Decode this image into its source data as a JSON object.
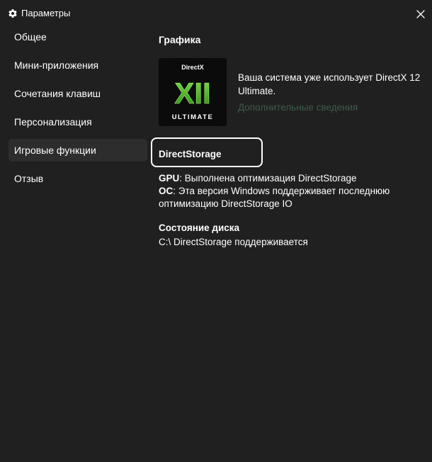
{
  "window": {
    "title": "Параметры"
  },
  "sidebar": {
    "items": [
      {
        "label": "Общее",
        "active": false
      },
      {
        "label": "Мини-приложения",
        "active": false
      },
      {
        "label": "Сочетания клавиш",
        "active": false
      },
      {
        "label": "Персонализация",
        "active": false
      },
      {
        "label": "Игровые функции",
        "active": true
      },
      {
        "label": "Отзыв",
        "active": false
      }
    ]
  },
  "main": {
    "section_title": "Графика",
    "directx": {
      "logo_top": "DirectX",
      "logo_numeral": "XII",
      "logo_bottom": "ULTIMATE",
      "description": "Ваша система уже использует DirectX 12 Ultimate.",
      "link": "Дополнительные сведения"
    },
    "directstorage": {
      "title": "DirectStorage",
      "gpu_label": "GPU",
      "gpu_text": ": Выполнена оптимизация DirectStorage",
      "os_label": "ОС",
      "os_text_1": ": Эта версия Windows поддерживает последнюю",
      "os_text_2": "оптимизацию DirectStorage IO"
    },
    "disk": {
      "title": "Состояние диска",
      "status": "C:\\ DirectStorage поддерживается"
    }
  },
  "colors": {
    "background": "#202020",
    "active_item": "#2d2d2d",
    "link": "#3d5c4a",
    "logo_green": "#4caf2a"
  }
}
